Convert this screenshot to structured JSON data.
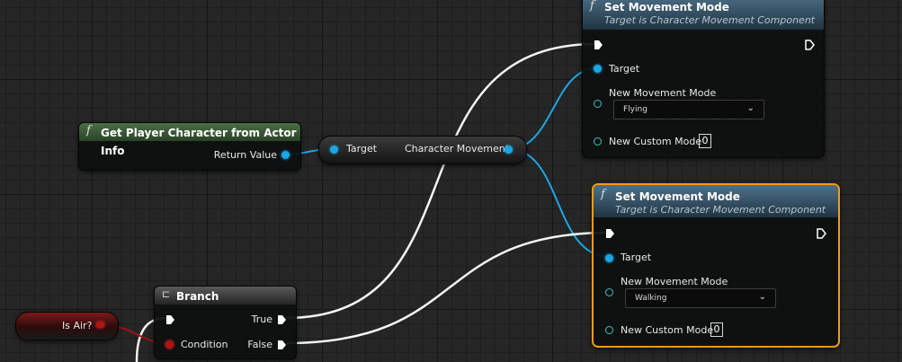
{
  "colors": {
    "exec_wire": "#ffffff",
    "object_pin": "#1aa7e6",
    "bool_pin": "#b41212",
    "selected_border": "#f39c12"
  },
  "getPlayer": {
    "title": "Get Player Character from Actor Info",
    "return_label": "Return Value",
    "icon": "function-icon"
  },
  "reroute": {
    "target_label": "Target",
    "output_label": "Character Movement"
  },
  "setMode1": {
    "title": "Set Movement Mode",
    "subtitle": "Target is Character Movement Component",
    "target_label": "Target",
    "new_mode_label": "New Movement Mode",
    "new_mode_value": "Flying",
    "custom_mode_label": "New Custom Mode",
    "custom_mode_value": "0"
  },
  "setMode2": {
    "title": "Set Movement Mode",
    "subtitle": "Target is Character Movement Component",
    "target_label": "Target",
    "new_mode_label": "New Movement Mode",
    "new_mode_value": "Walking",
    "custom_mode_label": "New Custom Mode",
    "custom_mode_value": "0",
    "selected": true
  },
  "branch": {
    "title": "Branch",
    "condition_label": "Condition",
    "true_label": "True",
    "false_label": "False",
    "icon": "branch-icon"
  },
  "isAir": {
    "label": "Is Air?"
  }
}
